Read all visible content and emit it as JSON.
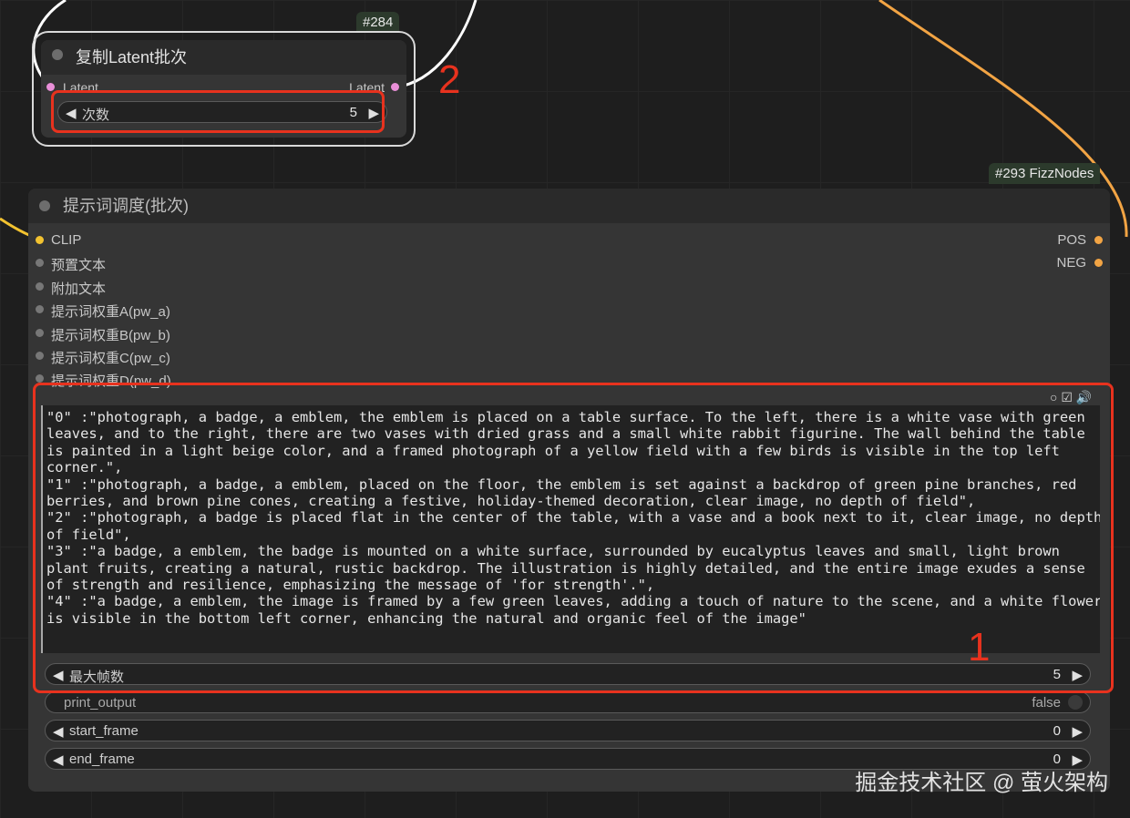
{
  "node_284": {
    "id": "#284",
    "title": "复制Latent批次",
    "input": "Latent",
    "output": "Latent",
    "widget": {
      "label": "次数",
      "value": "5"
    }
  },
  "node_293": {
    "id": "#293 FizzNodes",
    "title": "提示词调度(批次)",
    "inputs": [
      "CLIP",
      "预置文本",
      "附加文本",
      "提示词权重A(pw_a)",
      "提示词权重B(pw_b)",
      "提示词权重C(pw_c)",
      "提示词权重D(pw_d)"
    ],
    "outputs": [
      "POS",
      "NEG"
    ],
    "text_lines": [
      "\"0\" :\"photograph, a badge, a emblem, the emblem is placed on a table surface. To the left, there is a white vase with green",
      "leaves, and to the right, there are two vases with dried grass and a small white rabbit figurine. The wall behind the table",
      "is painted in a light beige color, and a framed photograph of a yellow field with a few birds is visible in the top left",
      "corner.\",",
      "\"1\" :\"photograph, a badge, a emblem, placed on the floor, the emblem is set against a backdrop of green pine branches, red",
      "berries, and brown pine cones, creating a festive, holiday-themed decoration, clear image, no depth of field\",",
      "\"2\" :\"photograph, a badge is placed flat in the center of the table, with a vase and a book next to it, clear image, no depth",
      "of field\",",
      "\"3\" :\"a badge, a emblem, the badge is mounted on a white surface, surrounded by eucalyptus leaves and small, light brown",
      "plant fruits, creating a natural, rustic backdrop. The illustration is highly detailed, and the entire image exudes a sense",
      "of strength and resilience, emphasizing the message of 'for strength'.\",",
      "\"4\" :\"a badge, a emblem, the image is framed by a few green leaves, adding a touch of nature to the scene, and a white flower",
      "is visible in the bottom left corner, enhancing the natural and organic feel of the image\""
    ],
    "widgets": {
      "max_frames": {
        "label": "最大帧数",
        "value": "5"
      },
      "print_output": {
        "label": "print_output",
        "value": "false"
      },
      "start_frame": {
        "label": "start_frame",
        "value": "0"
      },
      "end_frame": {
        "label": "end_frame",
        "value": "0"
      }
    }
  },
  "annotations": {
    "one": "1",
    "two": "2"
  },
  "watermark": "掘金技术社区 @ 萤火架构",
  "colors": {
    "latent_pin": "#e98fd8",
    "clip_pin": "#f2c230",
    "cond_pin": "#f2a444",
    "highlight": "#e8321e"
  }
}
